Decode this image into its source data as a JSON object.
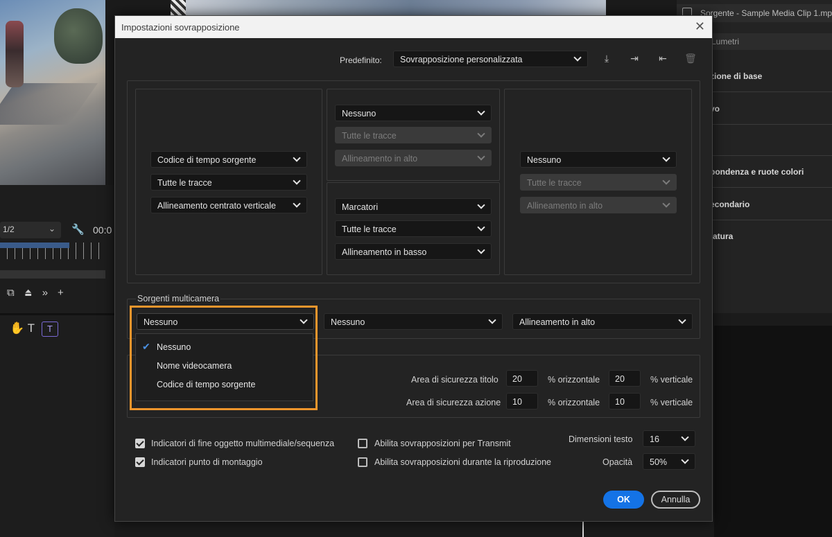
{
  "dialog": {
    "title": "Impostazioni sovrapposizione",
    "preset_label": "Predefinito:",
    "preset_value": "Sovrapposizione personalizzata",
    "toolbar_icons": [
      "save-preset-icon",
      "import-preset-icon",
      "export-preset-icon",
      "delete-preset-icon"
    ]
  },
  "grid": {
    "left": [
      "Codice di tempo sorgente",
      "Tutte le tracce",
      "Allineamento centrato verticale"
    ],
    "center_top": [
      "Nessuno",
      "Tutte le tracce",
      "Allineamento in alto"
    ],
    "center_bottom": [
      "Marcatori",
      "Tutte le tracce",
      "Allineamento in basso"
    ],
    "right": [
      "Nessuno",
      "Tutte le tracce",
      "Allineamento in alto"
    ]
  },
  "multicam": {
    "legend": "Sorgenti multicamera",
    "source": "Nessuno",
    "second": "Nessuno",
    "alignment": "Allineamento in alto",
    "options": [
      "Nessuno",
      "Nome videocamera",
      "Codice di tempo sorgente"
    ],
    "selected_option": "Nessuno"
  },
  "safe_areas": {
    "title_label": "Area di sicurezza titolo",
    "title_h": "20",
    "title_v": "20",
    "action_label": "Area di sicurezza azione",
    "action_h": "10",
    "action_v": "10",
    "h_unit": "% orizzontale",
    "v_unit": "% verticale"
  },
  "options": {
    "end_markers": "Indicatori di fine oggetto multimediale/sequenza",
    "end_markers_checked": true,
    "edit_points": "Indicatori punto di montaggio",
    "edit_points_checked": true,
    "transmit": "Abilita sovrapposizioni per Transmit",
    "transmit_checked": false,
    "playback": "Abilita sovrapposizioni durante la riproduzione",
    "playback_checked": false,
    "text_size_label": "Dimensioni testo",
    "text_size": "16",
    "opacity_label": "Opacità",
    "opacity": "50%"
  },
  "buttons": {
    "ok": "OK",
    "cancel": "Annulla"
  },
  "background": {
    "zoom": "1/2",
    "timecode": "00:0",
    "right_panel_title": "Sorgente - Sample Media Clip 1.mp",
    "right_panel_field": "Lumetri",
    "right_sections": [
      "zione di base",
      "vo",
      "pondenza e ruote colori",
      "econdario",
      "tatura"
    ]
  },
  "colors": {
    "accent": "#1473e6",
    "highlight": "#f0962c",
    "check": "#4a90e2"
  }
}
